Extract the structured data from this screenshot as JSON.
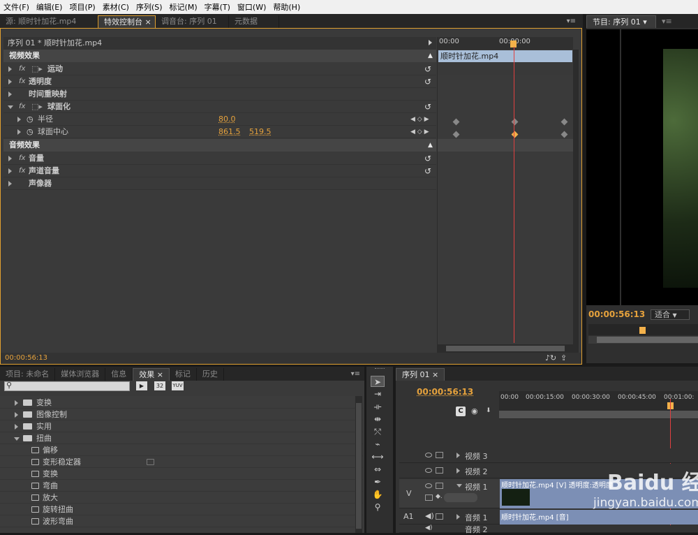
{
  "menu": [
    "文件(F)",
    "编辑(E)",
    "项目(P)",
    "素材(C)",
    "序列(S)",
    "标记(M)",
    "字幕(T)",
    "窗口(W)",
    "帮助(H)"
  ],
  "top_tabs": [
    "源: 顺时针加花.mp4",
    "特效控制台",
    "调音台: 序列 01",
    "元数据"
  ],
  "program_tab": "节目: 序列 01",
  "effect_controls": {
    "clip_header": "序列 01 * 顺时针加花.mp4",
    "ruler_start": "00:00",
    "ruler_mid": "00:00:00",
    "clip_bar": "顺时针加花.mp4",
    "video_section": "视频效果",
    "audio_section": "音频效果",
    "motion": "运动",
    "opacity": "透明度",
    "time_remap": "时间重映射",
    "spherize": "球面化",
    "radius": "半径",
    "radius_val": "80.0",
    "center": "球面中心",
    "center_x": "861.5",
    "center_y": "519.5",
    "volume": "音量",
    "channel_volume": "声道音量",
    "panner": "声像器",
    "timecode": "00:00:56:13",
    "fx": "fx"
  },
  "program": {
    "timecode": "00:00:56:13",
    "fit": "适合"
  },
  "project_tabs": [
    "项目: 未命名",
    "媒体浏览器",
    "信息",
    "效果",
    "标记",
    "历史"
  ],
  "effects_tree": {
    "icons": [
      "32",
      "YUV"
    ],
    "folders": [
      "变换",
      "图像控制",
      "实用",
      "扭曲"
    ],
    "items": [
      "偏移",
      "变形稳定器",
      "变换",
      "弯曲",
      "放大",
      "旋转扭曲",
      "波形弯曲"
    ]
  },
  "timeline": {
    "tab": "序列 01",
    "timecode": "00:00:56:13",
    "ruler": [
      "00:00",
      "00:00:15:00",
      "00:00:30:00",
      "00:00:45:00",
      "00:01:00:"
    ],
    "tracks": [
      {
        "name": "视频 3"
      },
      {
        "name": "视频 2"
      },
      {
        "name": "视频 1",
        "src": "V",
        "clip": "顺时针加花.mp4 [V] 透明度:透明度"
      },
      {
        "name": "音频 1",
        "src": "A1",
        "clip": "顺时针加花.mp4 [音]"
      },
      {
        "name": "音频 2"
      }
    ]
  },
  "watermark": "Baidu 经验",
  "watermark_url": "jingyan.baidu.com"
}
